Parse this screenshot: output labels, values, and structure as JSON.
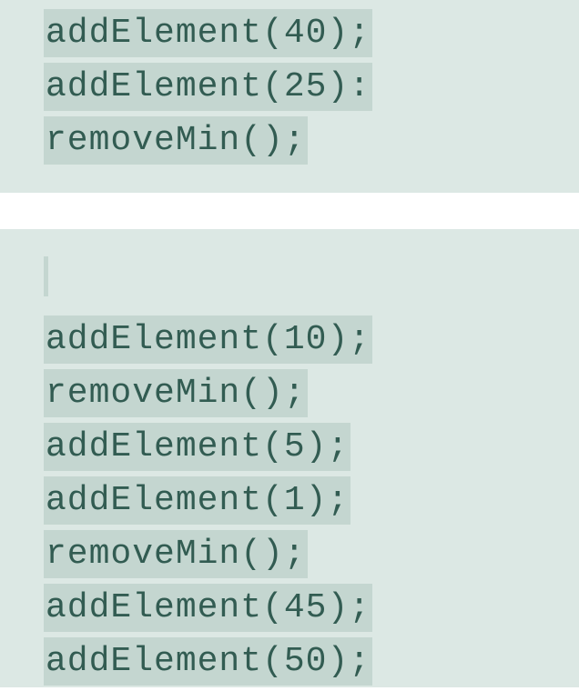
{
  "block1": {
    "lines": [
      "addElement(40);",
      "addElement(25):",
      "removeMin();"
    ]
  },
  "block2": {
    "lines": [
      "addElement(10);",
      "removeMin();",
      "addElement(5);",
      "addElement(1);",
      "removeMin();",
      "addElement(45);",
      "addElement(50);"
    ]
  }
}
